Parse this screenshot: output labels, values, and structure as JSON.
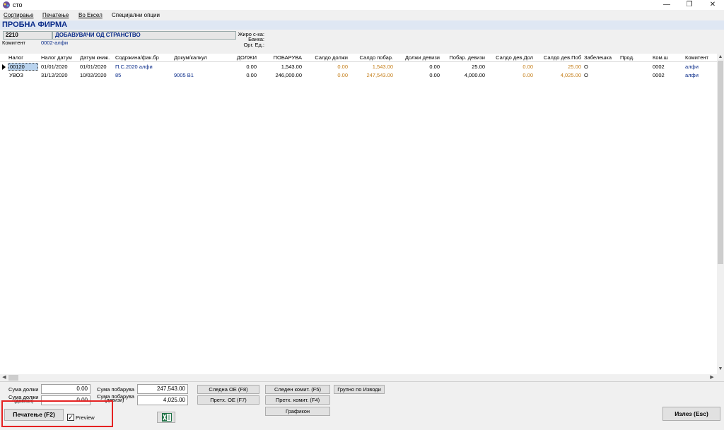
{
  "window": {
    "title": "сто",
    "minimize": "—",
    "restore": "❐",
    "close": "✕"
  },
  "menu": [
    "Сортирање",
    "Печатење",
    "Во Ексел",
    "Специјални опции"
  ],
  "company": {
    "name": "ПРОБНА ФИРМА"
  },
  "account": {
    "code": "2210",
    "name": "ДОБАВУВАЧИ ОД СТРАНСТВО",
    "komitent_label": "Комитент",
    "komitent_value": "0002-алфи",
    "ziro_label": "Жиро с-ка:",
    "banka_label": "Банка:",
    "org_label": "Орг. Ед.:"
  },
  "table": {
    "columns": [
      "Налог",
      "Налог датум",
      "Датум книж.",
      "Содржина/фак.бр",
      "Докум/калкул",
      "ДОЛЖИ",
      "ПОБАРУВА",
      "Салдо должи",
      "Салдо побар.",
      "Должи девизи",
      "Побар. девизи",
      "Салдо дев.Дол",
      "Салдо дев.Поб",
      "Забелешка",
      "Прод.",
      "Ком.ш",
      "Комитент"
    ],
    "rows": [
      [
        "00120",
        "01/01/2020",
        "01/01/2020",
        "П.С.2020 алфи",
        "",
        "0.00",
        "1,543.00",
        "0.00",
        "1,543.00",
        "0.00",
        "25.00",
        "0.00",
        "25.00",
        "О",
        "",
        "0002",
        "алфи"
      ],
      [
        "УВОЗ",
        "31/12/2020",
        "10/02/2020",
        "85",
        "9005  B1",
        "0.00",
        "246,000.00",
        "0.00",
        "247,543.00",
        "0.00",
        "4,000.00",
        "0.00",
        "4,025.00",
        "О",
        "",
        "0002",
        "алфи"
      ]
    ]
  },
  "summary": {
    "suma_dolzi_label": "Сума должи",
    "suma_dolzi_value": "0.00",
    "suma_dolzi_dev_label": "Сума должи",
    "suma_dolzi_dev_label2": "(девизи)",
    "suma_dolzi_dev_value": "0.00",
    "suma_pobaruva_label": "Сума побарува",
    "suma_pobaruva_value": "247,543.00",
    "suma_pobaruva_dev_label": "Сума побарува",
    "suma_pobaruva_dev_label2": "(девизи)",
    "suma_pobaruva_dev_value": "4,025.00"
  },
  "buttons": {
    "sledna_oe": "Следна ОЕ (F8)",
    "pretx_oe": "Претх. ОЕ (F7)",
    "sleden_komit": "Следен комит. (F5)",
    "pretx_komit": "Претх. комит. (F4)",
    "grafikon": "Графикон",
    "grupno": "Групно по Изводи",
    "pecatenje": "Печатење (F2)",
    "preview": "Preview",
    "izlez": "Излез (Esc)"
  },
  "colors": {
    "accent_blue": "#0a2c8a",
    "saldo_orange": "#c47d17",
    "highlight_red": "#e52222"
  }
}
